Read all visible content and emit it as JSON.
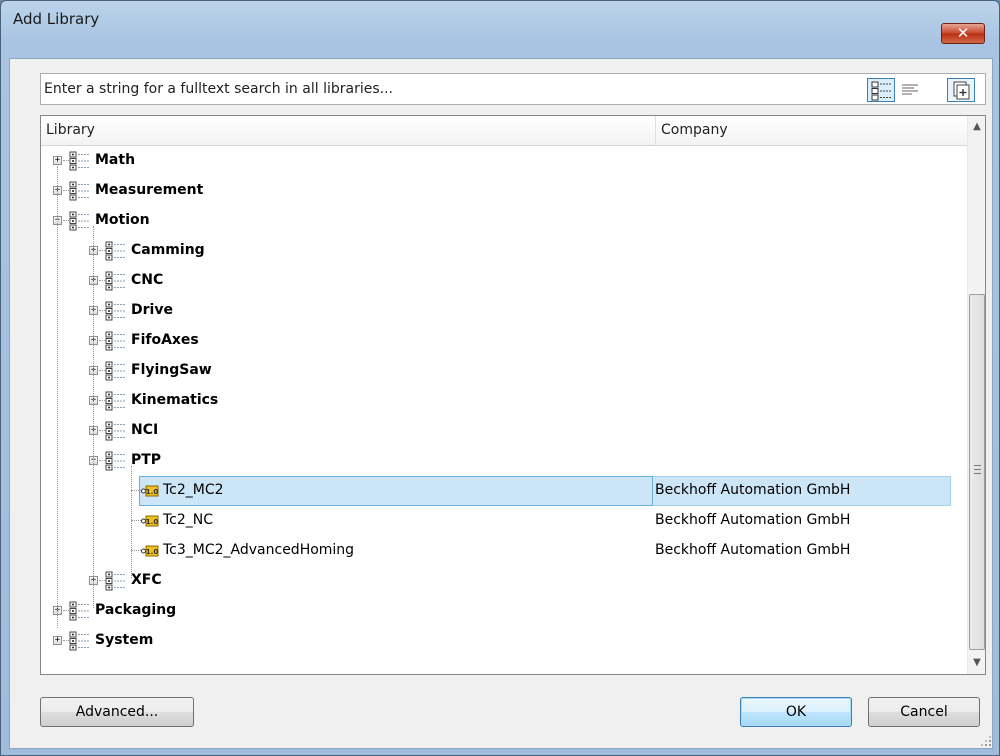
{
  "window": {
    "title": "Add Library",
    "close_glyph": "✕"
  },
  "search": {
    "placeholder": "Enter a string for a fulltext search in all libraries..."
  },
  "columns": {
    "library": "Library",
    "company": "Company"
  },
  "tree": [
    {
      "label": "Math",
      "type": "folder",
      "level": 0,
      "expander": "+"
    },
    {
      "label": "Measurement",
      "type": "folder",
      "level": 0,
      "expander": "+"
    },
    {
      "label": "Motion",
      "type": "folder",
      "level": 0,
      "expander": "−"
    },
    {
      "label": "Camming",
      "type": "folder",
      "level": 1,
      "expander": "+"
    },
    {
      "label": "CNC",
      "type": "folder",
      "level": 1,
      "expander": "+"
    },
    {
      "label": "Drive",
      "type": "folder",
      "level": 1,
      "expander": "+"
    },
    {
      "label": "FifoAxes",
      "type": "folder",
      "level": 1,
      "expander": "+"
    },
    {
      "label": "FlyingSaw",
      "type": "folder",
      "level": 1,
      "expander": "+"
    },
    {
      "label": "Kinematics",
      "type": "folder",
      "level": 1,
      "expander": "+"
    },
    {
      "label": "NCI",
      "type": "folder",
      "level": 1,
      "expander": "+"
    },
    {
      "label": "PTP",
      "type": "folder",
      "level": 1,
      "expander": "−"
    },
    {
      "label": "Tc2_MC2",
      "type": "library",
      "level": 2,
      "company": "Beckhoff Automation GmbH",
      "selected": true
    },
    {
      "label": "Tc2_NC",
      "type": "library",
      "level": 2,
      "company": "Beckhoff Automation GmbH"
    },
    {
      "label": "Tc3_MC2_AdvancedHoming",
      "type": "library",
      "level": 2,
      "company": "Beckhoff Automation GmbH"
    },
    {
      "label": "XFC",
      "type": "folder",
      "level": 1,
      "expander": "+"
    },
    {
      "label": "Packaging",
      "type": "folder",
      "level": 0,
      "expander": "+"
    },
    {
      "label": "System",
      "type": "folder",
      "level": 0,
      "expander": "+"
    }
  ],
  "buttons": {
    "advanced": "Advanced...",
    "ok": "OK",
    "cancel": "Cancel"
  },
  "icons": {
    "tree_view": "tree-view-icon",
    "list_view": "list-view-icon",
    "add_library": "add-library-icon",
    "folder": "library-category-icon",
    "library": "library-version-icon"
  },
  "colors": {
    "selection": "#cde6f7",
    "title_gradient": "#a9c4e2",
    "close_button": "#c7442b"
  }
}
